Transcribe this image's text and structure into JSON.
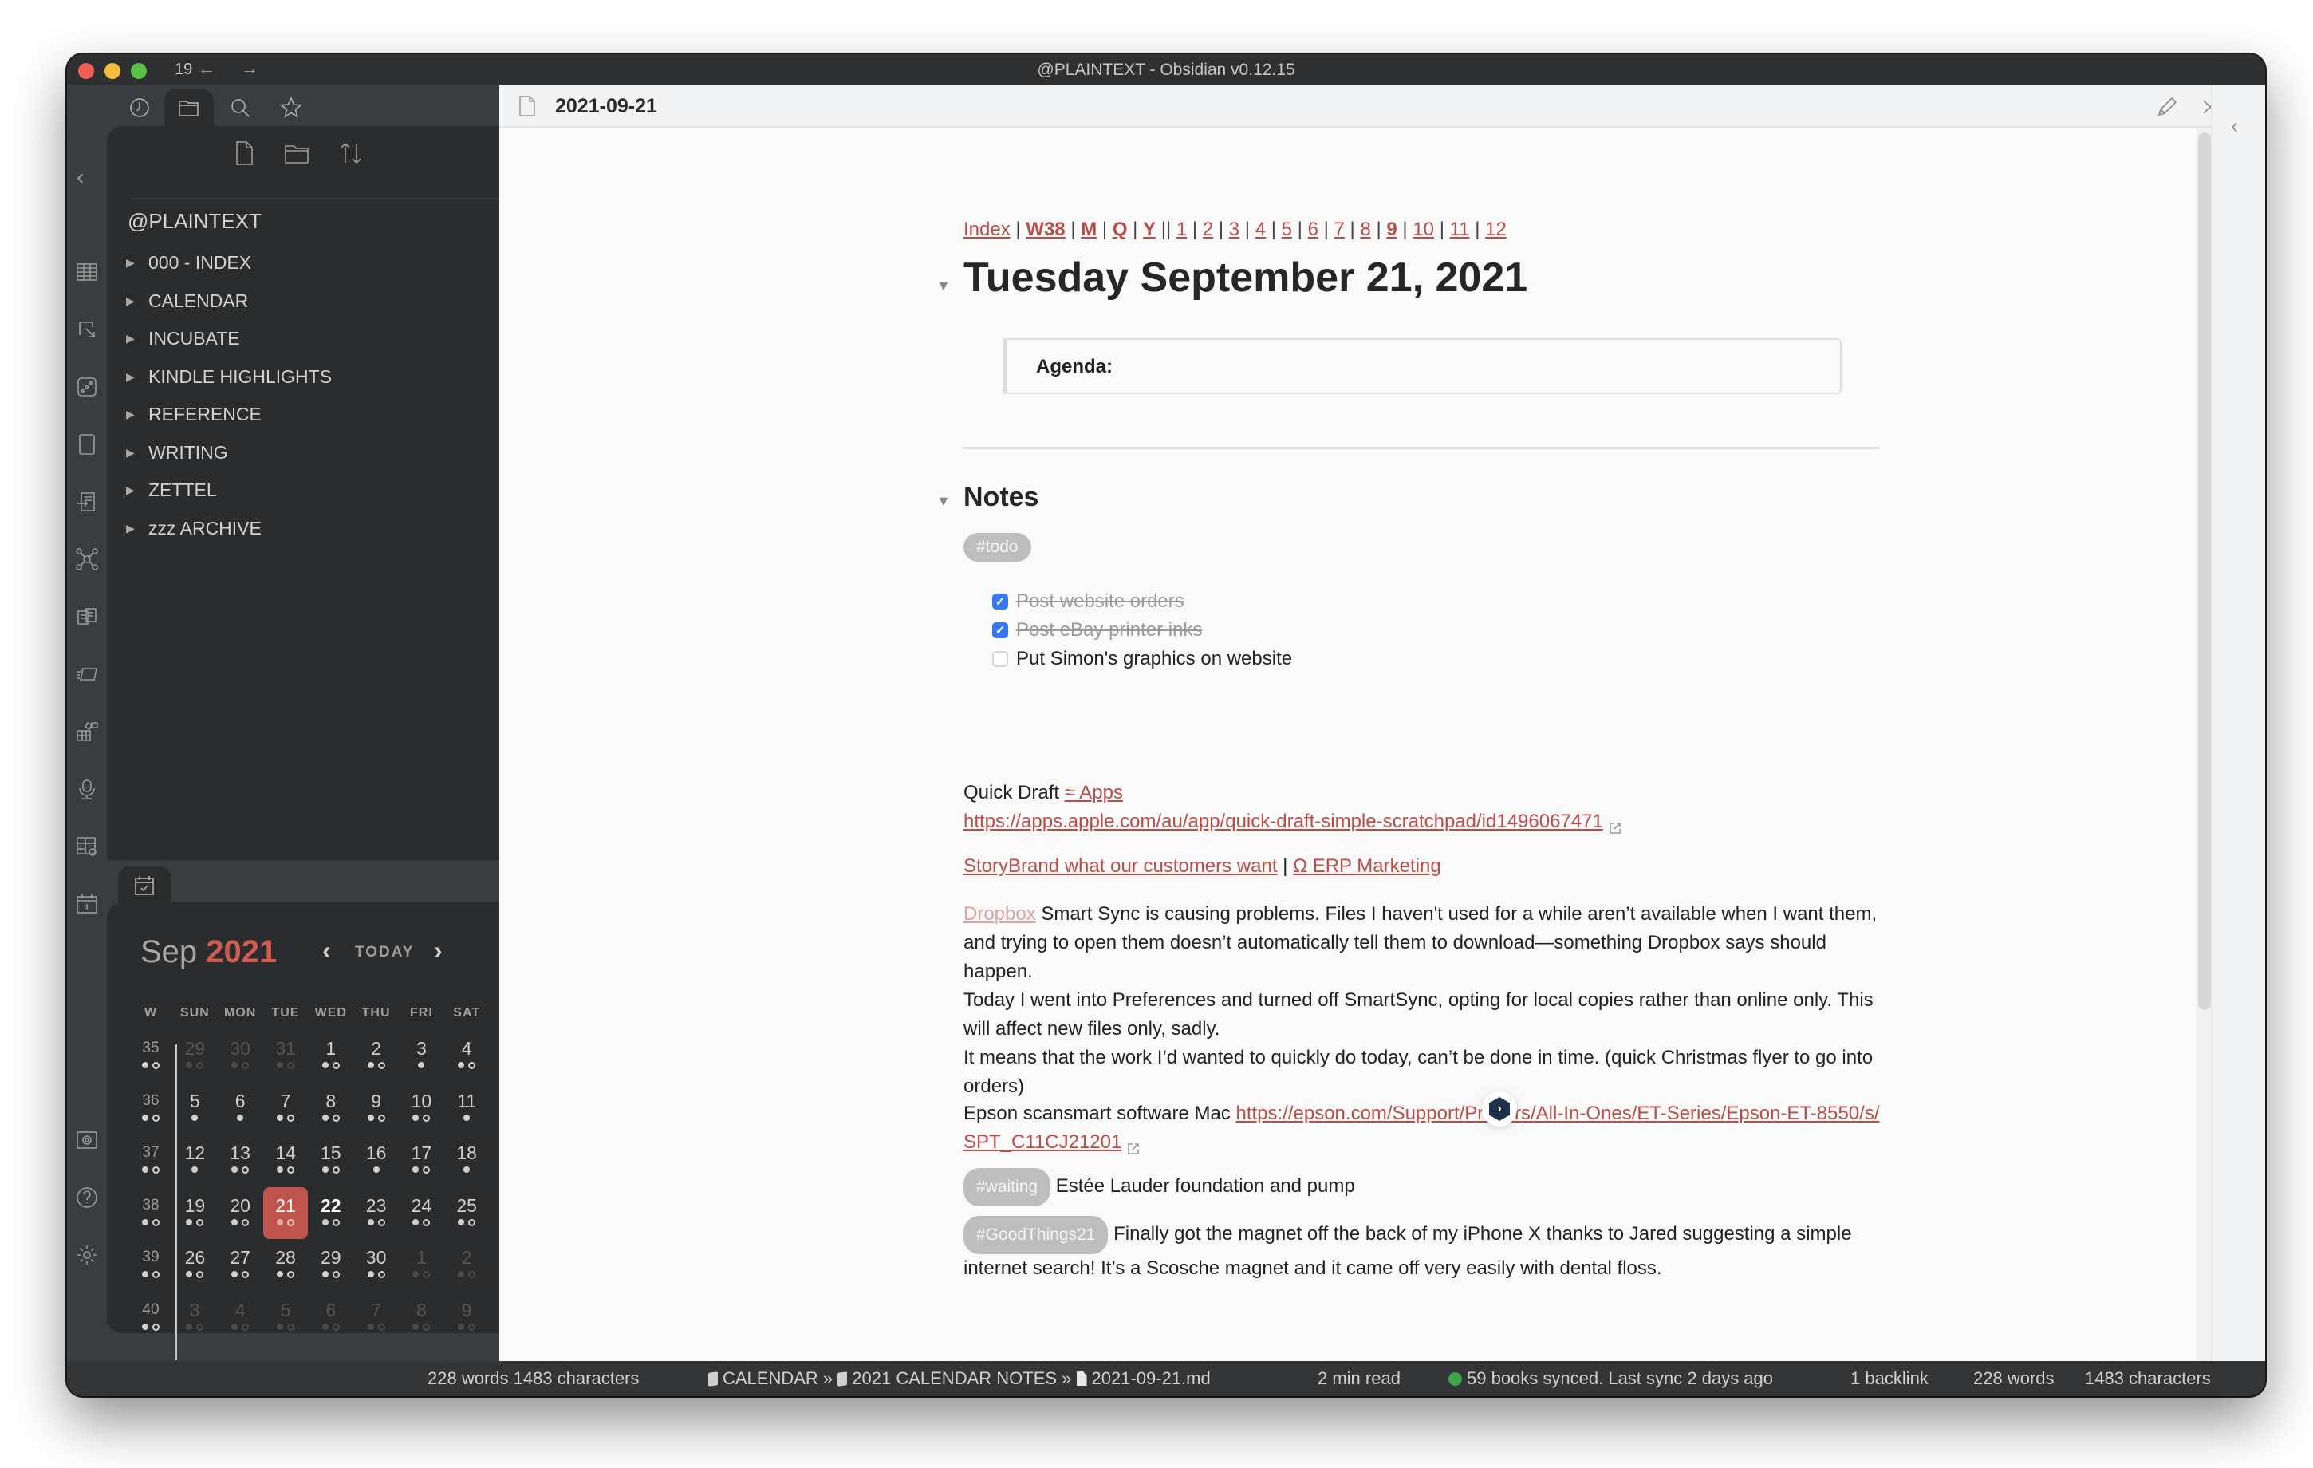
{
  "window": {
    "title": "@PLAINTEXT - Obsidian v0.12.15",
    "nav_count": "19",
    "nav_back": "←",
    "nav_forward": "→"
  },
  "ribbon": {
    "items": [
      "table-icon",
      "open-in-icon",
      "dice-icon",
      "tablet-icon",
      "import-icon",
      "graph-icon",
      "copy-files-icon",
      "slides-icon",
      "kanban-icon",
      "microphone-icon",
      "table-settings-icon",
      "calendar-day-icon"
    ],
    "bottom": [
      "vault-icon",
      "help-icon",
      "settings-icon"
    ]
  },
  "sidebar": {
    "tabs": [
      "recent-files-icon",
      "file-explorer-icon",
      "search-icon",
      "starred-icon"
    ],
    "active_tab": "file-explorer-icon",
    "actions": [
      "new-note-icon",
      "new-folder-icon",
      "sort-icon"
    ],
    "vault_name": "@PLAINTEXT",
    "folders": [
      {
        "label": "000 - INDEX"
      },
      {
        "label": "CALENDAR"
      },
      {
        "label": "INCUBATE"
      },
      {
        "label": "KINDLE HIGHLIGHTS"
      },
      {
        "label": "REFERENCE"
      },
      {
        "label": "WRITING"
      },
      {
        "label": "ZETTEL"
      },
      {
        "label": "zzz ARCHIVE"
      }
    ],
    "collapse_arrow": "‹"
  },
  "calendar": {
    "month": "Sep",
    "year": "2021",
    "prev": "‹",
    "today_label": "TODAY",
    "next": "›",
    "headers": [
      "W",
      "SUN",
      "MON",
      "TUE",
      "WED",
      "THU",
      "FRI",
      "SAT"
    ],
    "weeks": [
      {
        "week": "35",
        "wdots": "fr",
        "days": [
          [
            "29",
            "fr",
            1
          ],
          [
            "30",
            "fr",
            1
          ],
          [
            "31",
            "fr",
            1
          ],
          [
            "1",
            "fr",
            0
          ],
          [
            "2",
            "fr",
            0
          ],
          [
            "3",
            "f",
            0
          ],
          [
            "4",
            "fr",
            0
          ]
        ]
      },
      {
        "week": "36",
        "wdots": "fr",
        "days": [
          [
            "5",
            "f",
            0
          ],
          [
            "6",
            "f",
            0
          ],
          [
            "7",
            "fr",
            0
          ],
          [
            "8",
            "fr",
            0
          ],
          [
            "9",
            "fr",
            0
          ],
          [
            "10",
            "fr",
            0
          ],
          [
            "11",
            "f",
            0
          ]
        ]
      },
      {
        "week": "37",
        "wdots": "fr",
        "days": [
          [
            "12",
            "f",
            0
          ],
          [
            "13",
            "fr",
            0
          ],
          [
            "14",
            "fr",
            0
          ],
          [
            "15",
            "fr",
            0
          ],
          [
            "16",
            "f",
            0
          ],
          [
            "17",
            "fr",
            0
          ],
          [
            "18",
            "f",
            0
          ]
        ]
      },
      {
        "week": "38",
        "wdots": "fr",
        "days": [
          [
            "19",
            "fr",
            0
          ],
          [
            "20",
            "fr",
            0
          ],
          [
            "21",
            "fr",
            0,
            "today"
          ],
          [
            "22",
            "fr",
            0,
            "bold"
          ],
          [
            "23",
            "fr",
            0
          ],
          [
            "24",
            "fr",
            0
          ],
          [
            "25",
            "fr",
            0
          ]
        ]
      },
      {
        "week": "39",
        "wdots": "fr",
        "days": [
          [
            "26",
            "fr",
            0
          ],
          [
            "27",
            "fr",
            0
          ],
          [
            "28",
            "fr",
            0
          ],
          [
            "29",
            "fr",
            0
          ],
          [
            "30",
            "fr",
            0
          ],
          [
            "1",
            "fr",
            1
          ],
          [
            "2",
            "fr",
            1
          ]
        ]
      },
      {
        "week": "40",
        "wdots": "fr",
        "days": [
          [
            "3",
            "fr",
            1
          ],
          [
            "4",
            "fr",
            1
          ],
          [
            "5",
            "fr",
            1
          ],
          [
            "6",
            "fr",
            1
          ],
          [
            "7",
            "fr",
            1
          ],
          [
            "8",
            "fr",
            1
          ],
          [
            "9",
            "fr",
            1
          ]
        ]
      }
    ]
  },
  "editor": {
    "tab_title": "2021-09-21",
    "header_actions": [
      "edit-icon",
      "close-icon",
      "more-options-icon"
    ],
    "nav_links": [
      {
        "text": "Index",
        "bold": false
      },
      {
        "sep": " | "
      },
      {
        "text": "W38",
        "bold": true
      },
      {
        "sep": " | "
      },
      {
        "text": "M",
        "bold": true
      },
      {
        "sep": " | "
      },
      {
        "text": "Q",
        "bold": true
      },
      {
        "sep": " | "
      },
      {
        "text": "Y",
        "bold": true
      },
      {
        "sep": " || "
      },
      {
        "text": "1"
      },
      {
        "sep": " | "
      },
      {
        "text": "2"
      },
      {
        "sep": " | "
      },
      {
        "text": "3"
      },
      {
        "sep": " | "
      },
      {
        "text": "4"
      },
      {
        "sep": " | "
      },
      {
        "text": "5"
      },
      {
        "sep": " | "
      },
      {
        "text": "6"
      },
      {
        "sep": " | "
      },
      {
        "text": "7"
      },
      {
        "sep": " | "
      },
      {
        "text": "8"
      },
      {
        "sep": " | "
      },
      {
        "text": "9",
        "bold": true
      },
      {
        "sep": " | "
      },
      {
        "text": "10"
      },
      {
        "sep": " | "
      },
      {
        "text": "11"
      },
      {
        "sep": " | "
      },
      {
        "text": "12"
      }
    ],
    "heading": "Tuesday September 21, 2021",
    "agenda_label": "Agenda:",
    "notes_heading": "Notes",
    "todo_tag": "#todo",
    "tasks": [
      {
        "text": "Post website orders",
        "done": true
      },
      {
        "text": "Post eBay printer inks",
        "done": true
      },
      {
        "text": "Put Simon's graphics on website",
        "done": false
      }
    ],
    "quick_draft": {
      "label": "Quick Draft ",
      "link": "≈ Apps",
      "url": "https://apps.apple.com/au/app/quick-draft-simple-scratchpad/id1496067471"
    },
    "storybrand": {
      "link1": "StoryBrand what our customers want",
      "sep": " | ",
      "link2": "Ω ERP Marketing"
    },
    "dropbox": {
      "link": "Dropbox",
      "line1": " Smart Sync is causing problems. Files I haven't used for a while aren’t available when I want them, and trying to open them doesn’t automatically tell them to download—something Dropbox says should happen.",
      "line2": "Today I went into Preferences and turned off SmartSync, opting for local copies rather than online only. This will affect new files only, sadly.",
      "line3": "It means that the work I’d wanted to quickly do today, can’t be done in time. (quick Christmas flyer to go into orders)"
    },
    "epson": {
      "label": "Epson scansmart software Mac ",
      "url": "https://epson.com/Support/Printers/All-In-Ones/ET-Series/Epson-ET-8550/s/SPT_C11CJ21201"
    },
    "waiting": {
      "tag": "#waiting",
      "text": " Estée Lauder foundation and pump"
    },
    "goodthings": {
      "tag": "#GoodThings21",
      "text": " Finally got the magnet off the back of my iPhone X thanks to Jared suggesting a simple internet search! It’s a Scosche magnet and it came off very easily with dental floss."
    }
  },
  "statusbar": {
    "left_counts": "228 words 1483 characters",
    "breadcrumb": [
      "CALENDAR",
      "2021 CALENDAR NOTES",
      "2021-09-21.md"
    ],
    "breadcrumb_sep": " » ",
    "read_time": "2 min read",
    "sync": "59 books synced. Last sync 2 days ago",
    "backlinks": "1 backlink",
    "words": "228 words",
    "characters": "1483 characters"
  },
  "colors": {
    "accent": "#c0544d",
    "link": "#b84e47",
    "checkbox": "#3478f6",
    "sync_ok": "#3ba34a"
  }
}
